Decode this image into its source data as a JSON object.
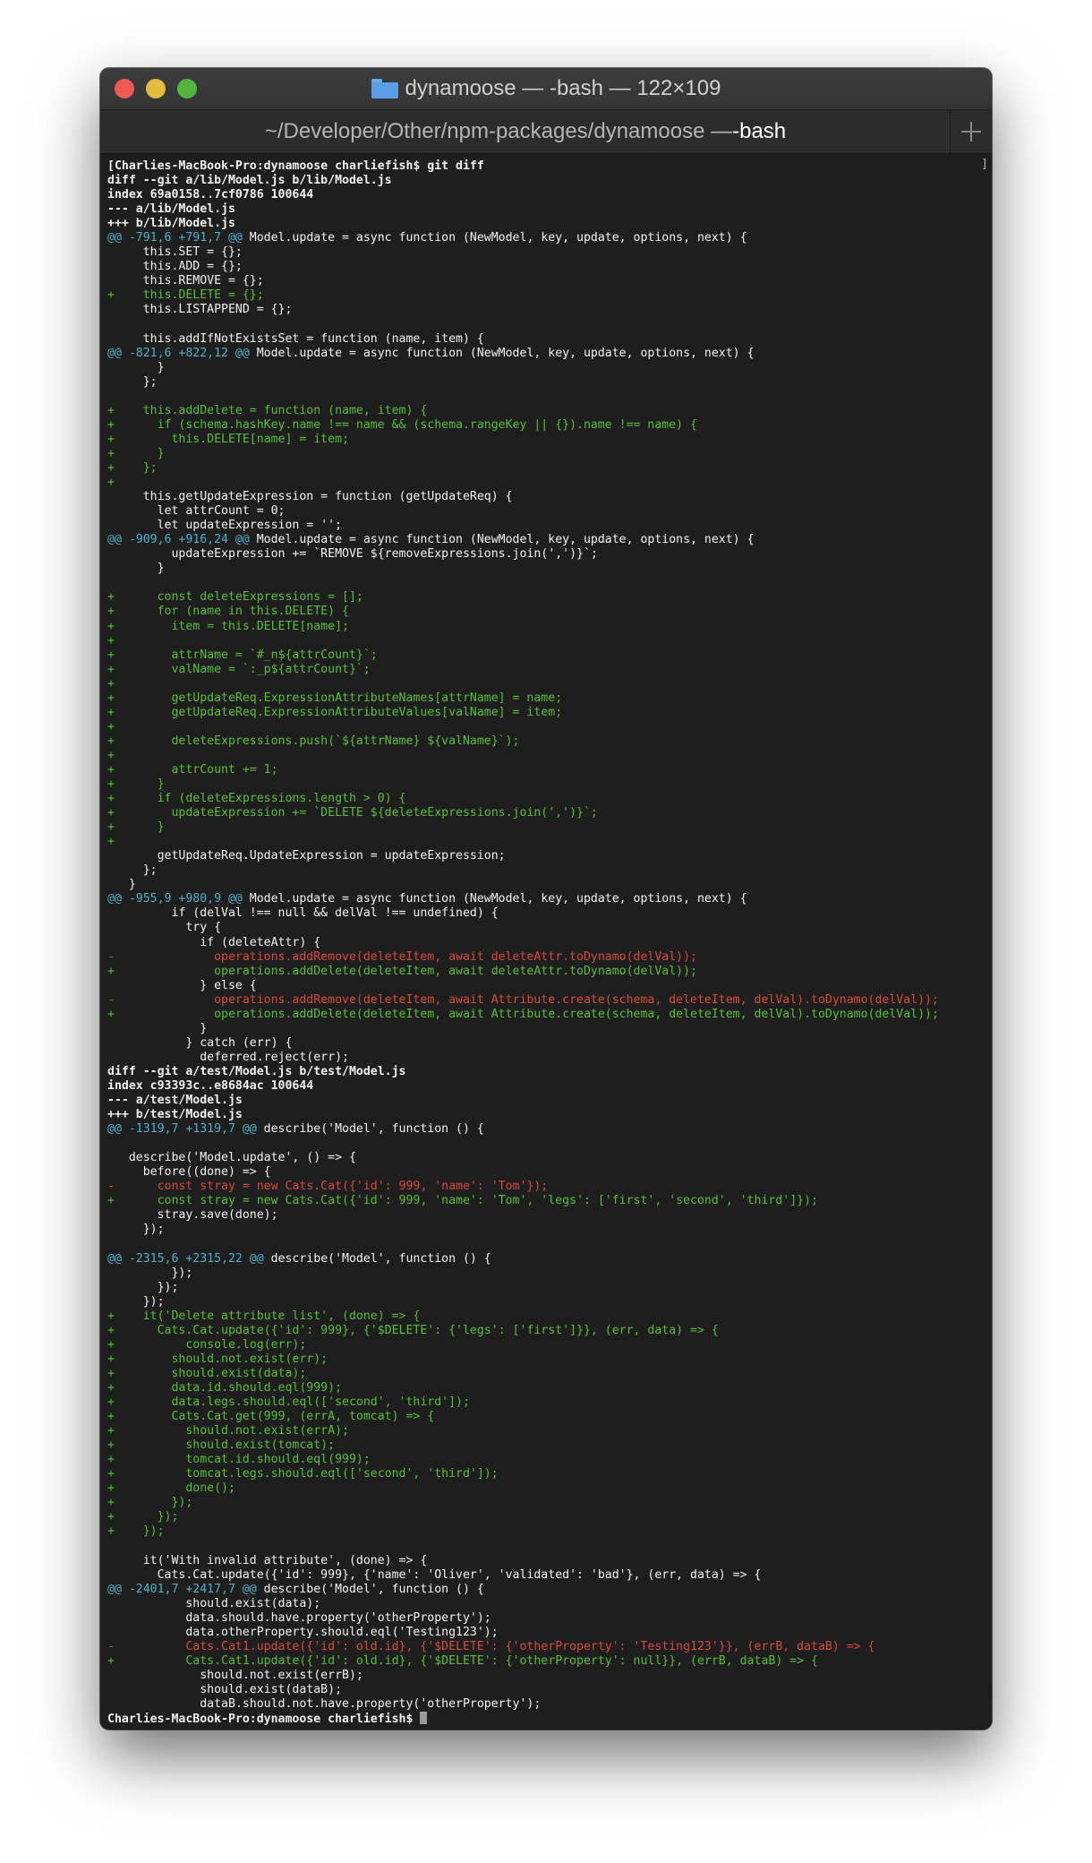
{
  "window": {
    "title": "dynamoose — -bash — 122×109",
    "tab_path_prefix": "~/Developer/Other/npm-packages/dynamoose — ",
    "tab_path_strong": "-bash",
    "scroll_marker": "]"
  },
  "terminal": {
    "lines": [
      {
        "t": "bold",
        "x": "[Charlies-MacBook-Pro:dynamoose charliefish$ git diff"
      },
      {
        "t": "bold",
        "x": "diff --git a/lib/Model.js b/lib/Model.js"
      },
      {
        "t": "bold",
        "x": "index 69a0158..7cf0786 100644"
      },
      {
        "t": "bold",
        "x": "--- a/lib/Model.js"
      },
      {
        "t": "bold",
        "x": "+++ b/lib/Model.js"
      },
      {
        "t": "hunk",
        "h": "@@ -791,6 +791,7 @@",
        "x": " Model.update = async function (NewModel, key, update, options, next) {"
      },
      {
        "t": "plain",
        "x": "     this.SET = {};"
      },
      {
        "t": "plain",
        "x": "     this.ADD = {};"
      },
      {
        "t": "plain",
        "x": "     this.REMOVE = {};"
      },
      {
        "t": "add",
        "x": "+    this.DELETE = {};"
      },
      {
        "t": "plain",
        "x": "     this.LISTAPPEND = {};"
      },
      {
        "t": "plain",
        "x": ""
      },
      {
        "t": "plain",
        "x": "     this.addIfNotExistsSet = function (name, item) {"
      },
      {
        "t": "hunk",
        "h": "@@ -821,6 +822,12 @@",
        "x": " Model.update = async function (NewModel, key, update, options, next) {"
      },
      {
        "t": "plain",
        "x": "       }"
      },
      {
        "t": "plain",
        "x": "     };"
      },
      {
        "t": "plain",
        "x": ""
      },
      {
        "t": "add",
        "x": "+    this.addDelete = function (name, item) {"
      },
      {
        "t": "add",
        "x": "+      if (schema.hashKey.name !== name && (schema.rangeKey || {}).name !== name) {"
      },
      {
        "t": "add",
        "x": "+        this.DELETE[name] = item;"
      },
      {
        "t": "add",
        "x": "+      }"
      },
      {
        "t": "add",
        "x": "+    };"
      },
      {
        "t": "add",
        "x": "+"
      },
      {
        "t": "plain",
        "x": "     this.getUpdateExpression = function (getUpdateReq) {"
      },
      {
        "t": "plain",
        "x": "       let attrCount = 0;"
      },
      {
        "t": "plain",
        "x": "       let updateExpression = '';"
      },
      {
        "t": "hunk",
        "h": "@@ -909,6 +916,24 @@",
        "x": " Model.update = async function (NewModel, key, update, options, next) {"
      },
      {
        "t": "plain",
        "x": "         updateExpression += `REMOVE ${removeExpressions.join(',')}`;"
      },
      {
        "t": "plain",
        "x": "       }"
      },
      {
        "t": "plain",
        "x": ""
      },
      {
        "t": "add",
        "x": "+      const deleteExpressions = [];"
      },
      {
        "t": "add",
        "x": "+      for (name in this.DELETE) {"
      },
      {
        "t": "add",
        "x": "+        item = this.DELETE[name];"
      },
      {
        "t": "add",
        "x": "+"
      },
      {
        "t": "add",
        "x": "+        attrName = `#_n${attrCount}`;"
      },
      {
        "t": "add",
        "x": "+        valName = `:_p${attrCount}`;"
      },
      {
        "t": "add",
        "x": "+"
      },
      {
        "t": "add",
        "x": "+        getUpdateReq.ExpressionAttributeNames[attrName] = name;"
      },
      {
        "t": "add",
        "x": "+        getUpdateReq.ExpressionAttributeValues[valName] = item;"
      },
      {
        "t": "add",
        "x": "+"
      },
      {
        "t": "add",
        "x": "+        deleteExpressions.push(`${attrName} ${valName}`);"
      },
      {
        "t": "add",
        "x": "+"
      },
      {
        "t": "add",
        "x": "+        attrCount += 1;"
      },
      {
        "t": "add",
        "x": "+      }"
      },
      {
        "t": "add",
        "x": "+      if (deleteExpressions.length > 0) {"
      },
      {
        "t": "add",
        "x": "+        updateExpression += `DELETE ${deleteExpressions.join(',')}`;"
      },
      {
        "t": "add",
        "x": "+      }"
      },
      {
        "t": "add",
        "x": "+"
      },
      {
        "t": "plain",
        "x": "       getUpdateReq.UpdateExpression = updateExpression;"
      },
      {
        "t": "plain",
        "x": "     };"
      },
      {
        "t": "plain",
        "x": "   }"
      },
      {
        "t": "hunk",
        "h": "@@ -955,9 +980,9 @@",
        "x": " Model.update = async function (NewModel, key, update, options, next) {"
      },
      {
        "t": "plain",
        "x": "         if (delVal !== null && delVal !== undefined) {"
      },
      {
        "t": "plain",
        "x": "           try {"
      },
      {
        "t": "plain",
        "x": "             if (deleteAttr) {"
      },
      {
        "t": "del",
        "x": "-              operations.addRemove(deleteItem, await deleteAttr.toDynamo(delVal));"
      },
      {
        "t": "add",
        "x": "+              operations.addDelete(deleteItem, await deleteAttr.toDynamo(delVal));"
      },
      {
        "t": "plain",
        "x": "             } else {"
      },
      {
        "t": "del",
        "x": "-              operations.addRemove(deleteItem, await Attribute.create(schema, deleteItem, delVal).toDynamo(delVal));"
      },
      {
        "t": "add",
        "x": "+              operations.addDelete(deleteItem, await Attribute.create(schema, deleteItem, delVal).toDynamo(delVal));"
      },
      {
        "t": "plain",
        "x": "             }"
      },
      {
        "t": "plain",
        "x": "           } catch (err) {"
      },
      {
        "t": "plain",
        "x": "             deferred.reject(err);"
      },
      {
        "t": "bold",
        "x": "diff --git a/test/Model.js b/test/Model.js"
      },
      {
        "t": "bold",
        "x": "index c93393c..e8684ac 100644"
      },
      {
        "t": "bold",
        "x": "--- a/test/Model.js"
      },
      {
        "t": "bold",
        "x": "+++ b/test/Model.js"
      },
      {
        "t": "hunk",
        "h": "@@ -1319,7 +1319,7 @@",
        "x": " describe('Model', function () {"
      },
      {
        "t": "plain",
        "x": ""
      },
      {
        "t": "plain",
        "x": "   describe('Model.update', () => {"
      },
      {
        "t": "plain",
        "x": "     before((done) => {"
      },
      {
        "t": "del",
        "x": "-      const stray = new Cats.Cat({'id': 999, 'name': 'Tom'});"
      },
      {
        "t": "add",
        "x": "+      const stray = new Cats.Cat({'id': 999, 'name': 'Tom', 'legs': ['first', 'second', 'third']});"
      },
      {
        "t": "plain",
        "x": "       stray.save(done);"
      },
      {
        "t": "plain",
        "x": "     });"
      },
      {
        "t": "plain",
        "x": ""
      },
      {
        "t": "hunk",
        "h": "@@ -2315,6 +2315,22 @@",
        "x": " describe('Model', function () {"
      },
      {
        "t": "plain",
        "x": "         });"
      },
      {
        "t": "plain",
        "x": "       });"
      },
      {
        "t": "plain",
        "x": "     });"
      },
      {
        "t": "add",
        "x": "+    it('Delete attribute list', (done) => {"
      },
      {
        "t": "add",
        "x": "+      Cats.Cat.update({'id': 999}, {'$DELETE': {'legs': ['first']}}, (err, data) => {"
      },
      {
        "t": "add",
        "x": "+          console.log(err);"
      },
      {
        "t": "add",
        "x": "+        should.not.exist(err);"
      },
      {
        "t": "add",
        "x": "+        should.exist(data);"
      },
      {
        "t": "add",
        "x": "+        data.id.should.eql(999);"
      },
      {
        "t": "add",
        "x": "+        data.legs.should.eql(['second', 'third']);"
      },
      {
        "t": "add",
        "x": "+        Cats.Cat.get(999, (errA, tomcat) => {"
      },
      {
        "t": "add",
        "x": "+          should.not.exist(errA);"
      },
      {
        "t": "add",
        "x": "+          should.exist(tomcat);"
      },
      {
        "t": "add",
        "x": "+          tomcat.id.should.eql(999);"
      },
      {
        "t": "add",
        "x": "+          tomcat.legs.should.eql(['second', 'third']);"
      },
      {
        "t": "add",
        "x": "+          done();"
      },
      {
        "t": "add",
        "x": "+        });"
      },
      {
        "t": "add",
        "x": "+      });"
      },
      {
        "t": "add",
        "x": "+    });"
      },
      {
        "t": "plain",
        "x": ""
      },
      {
        "t": "plain",
        "x": "     it('With invalid attribute', (done) => {"
      },
      {
        "t": "plain",
        "x": "       Cats.Cat.update({'id': 999}, {'name': 'Oliver', 'validated': 'bad'}, (err, data) => {"
      },
      {
        "t": "hunk",
        "h": "@@ -2401,7 +2417,7 @@",
        "x": " describe('Model', function () {"
      },
      {
        "t": "plain",
        "x": "           should.exist(data);"
      },
      {
        "t": "plain",
        "x": "           data.should.have.property('otherProperty');"
      },
      {
        "t": "plain",
        "x": "           data.otherProperty.should.eql('Testing123');"
      },
      {
        "t": "del",
        "x": "-          Cats.Cat1.update({'id': old.id}, {'$DELETE': {'otherProperty': 'Testing123'}}, (errB, dataB) => {"
      },
      {
        "t": "add",
        "x": "+          Cats.Cat1.update({'id': old.id}, {'$DELETE': {'otherProperty': null}}, (errB, dataB) => {"
      },
      {
        "t": "plain",
        "x": "             should.not.exist(errB);"
      },
      {
        "t": "plain",
        "x": "             should.exist(dataB);"
      },
      {
        "t": "plain",
        "x": "             dataB.should.not.have.property('otherProperty');"
      },
      {
        "t": "prompt",
        "x": "Charlies-MacBook-Pro:dynamoose charliefish$ "
      }
    ]
  }
}
